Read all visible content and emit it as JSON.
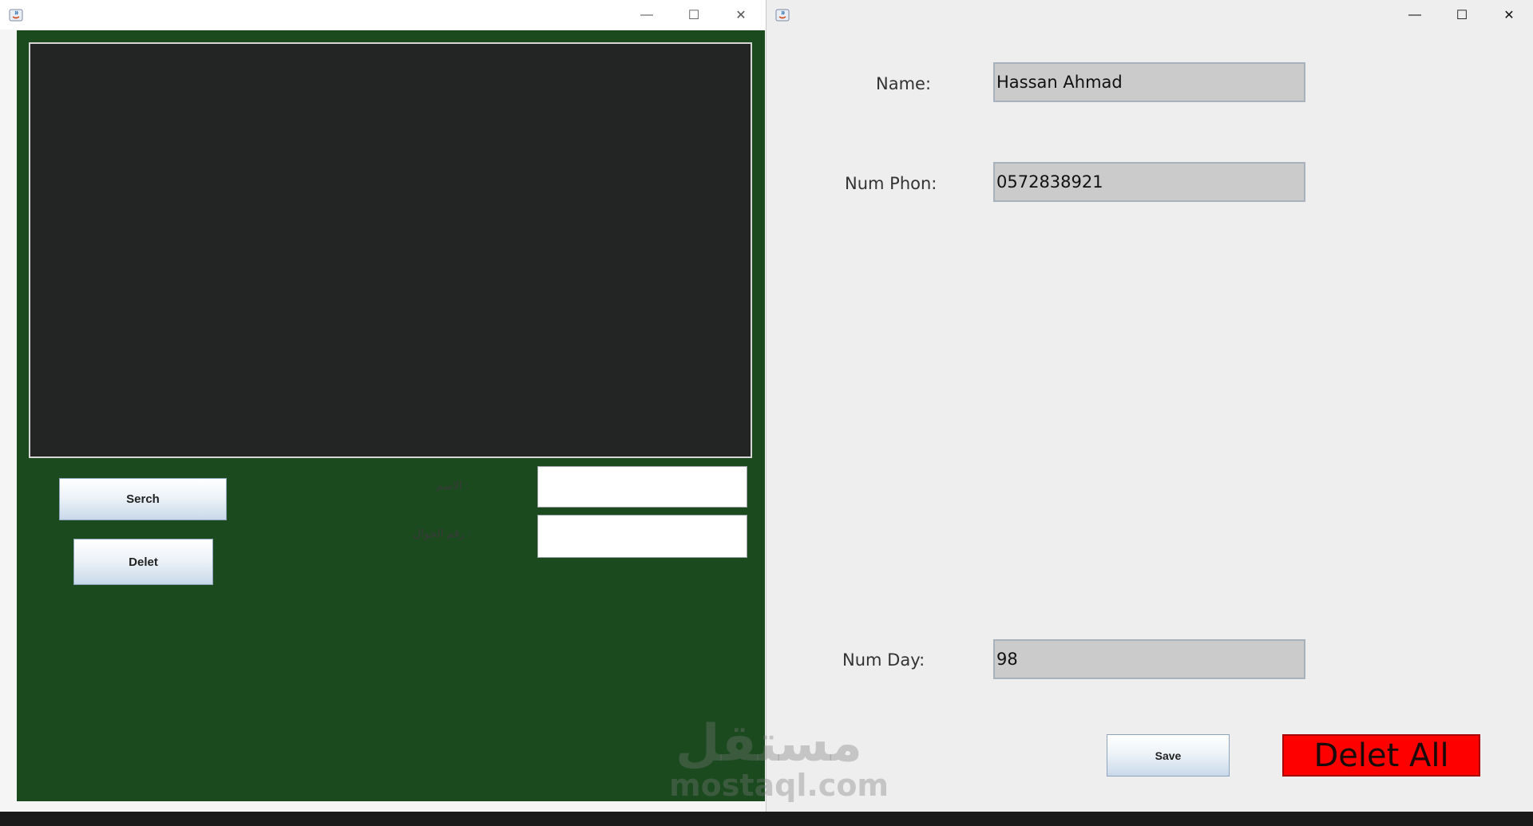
{
  "left_window": {
    "controls": {
      "minimize": "—",
      "maximize": "☐",
      "close": "✕"
    },
    "search_button": "Serch",
    "delete_button": "Delet",
    "label_one": "الاسم :",
    "label_two": "رقم الجوال :",
    "colors": {
      "panel": "#1b4a1f",
      "text_area": "#232424"
    }
  },
  "right_window": {
    "controls": {
      "minimize": "—",
      "maximize": "☐",
      "close": "✕"
    },
    "name_label": "Name:",
    "name_value": "Hassan Ahmad",
    "phone_label": "Num Phon:",
    "phone_value": "0572838921",
    "days_label": "Num Day:",
    "days_value": "98",
    "save_button": "Save",
    "delete_all_button": "Delet All",
    "colors": {
      "delete_all_bg": "#ff0000",
      "field_bg": "#cbcbcb"
    }
  },
  "watermark": {
    "arabic": "مستقل",
    "latin": "mostaql.com"
  }
}
